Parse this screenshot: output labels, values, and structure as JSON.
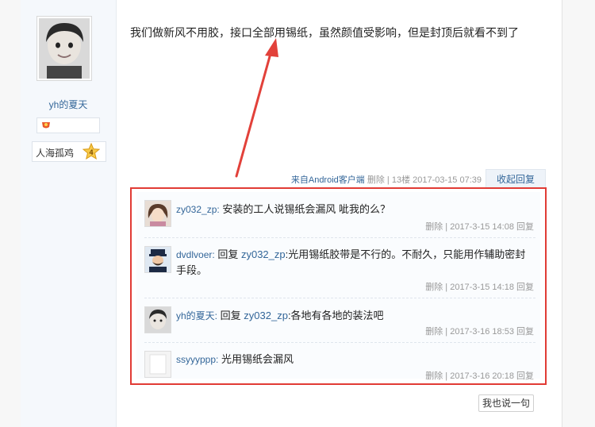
{
  "author": {
    "username": "yh的夏天",
    "rank_label": "人海孤鸡",
    "rank_level": "4"
  },
  "post": {
    "content": "我们做新风不用胶，接口全部用锡纸，虽然颜值受影响，但是封顶后就看不到了",
    "source": "来自Android客户端",
    "delete_label": "删除",
    "floor": "13楼",
    "timestamp": "2017-03-15 07:39",
    "collapse_label": "收起回复"
  },
  "comments": [
    {
      "user": "zy032_zp:",
      "reply_prefix": "",
      "mention": "",
      "text": "安装的工人说锡纸会漏风 呲我的么？",
      "delete_label": "删除",
      "time": "2017-3-15 14:08",
      "reply_label": "回复"
    },
    {
      "user": "dvdlvoer:",
      "reply_prefix": "回复",
      "mention": "zy032_zp",
      "text": ":光用锡纸胶带是不行的。不耐久，只能用作辅助密封手段。",
      "delete_label": "删除",
      "time": "2017-3-15 14:18",
      "reply_label": "回复"
    },
    {
      "user": "yh的夏天:",
      "reply_prefix": "回复",
      "mention": "zy032_zp",
      "text": ":各地有各地的装法吧",
      "delete_label": "删除",
      "time": "2017-3-16 18:53",
      "reply_label": "回复"
    },
    {
      "user": "ssyyyppp:",
      "reply_prefix": "",
      "mention": "",
      "text": "光用锡纸会漏风",
      "delete_label": "删除",
      "time": "2017-3-16 20:18",
      "reply_label": "回复"
    }
  ],
  "reply_button_label": "我也说一句",
  "colors": {
    "accent": "#336699",
    "highlight_border": "#e13b35",
    "arrow": "#e2413a"
  }
}
